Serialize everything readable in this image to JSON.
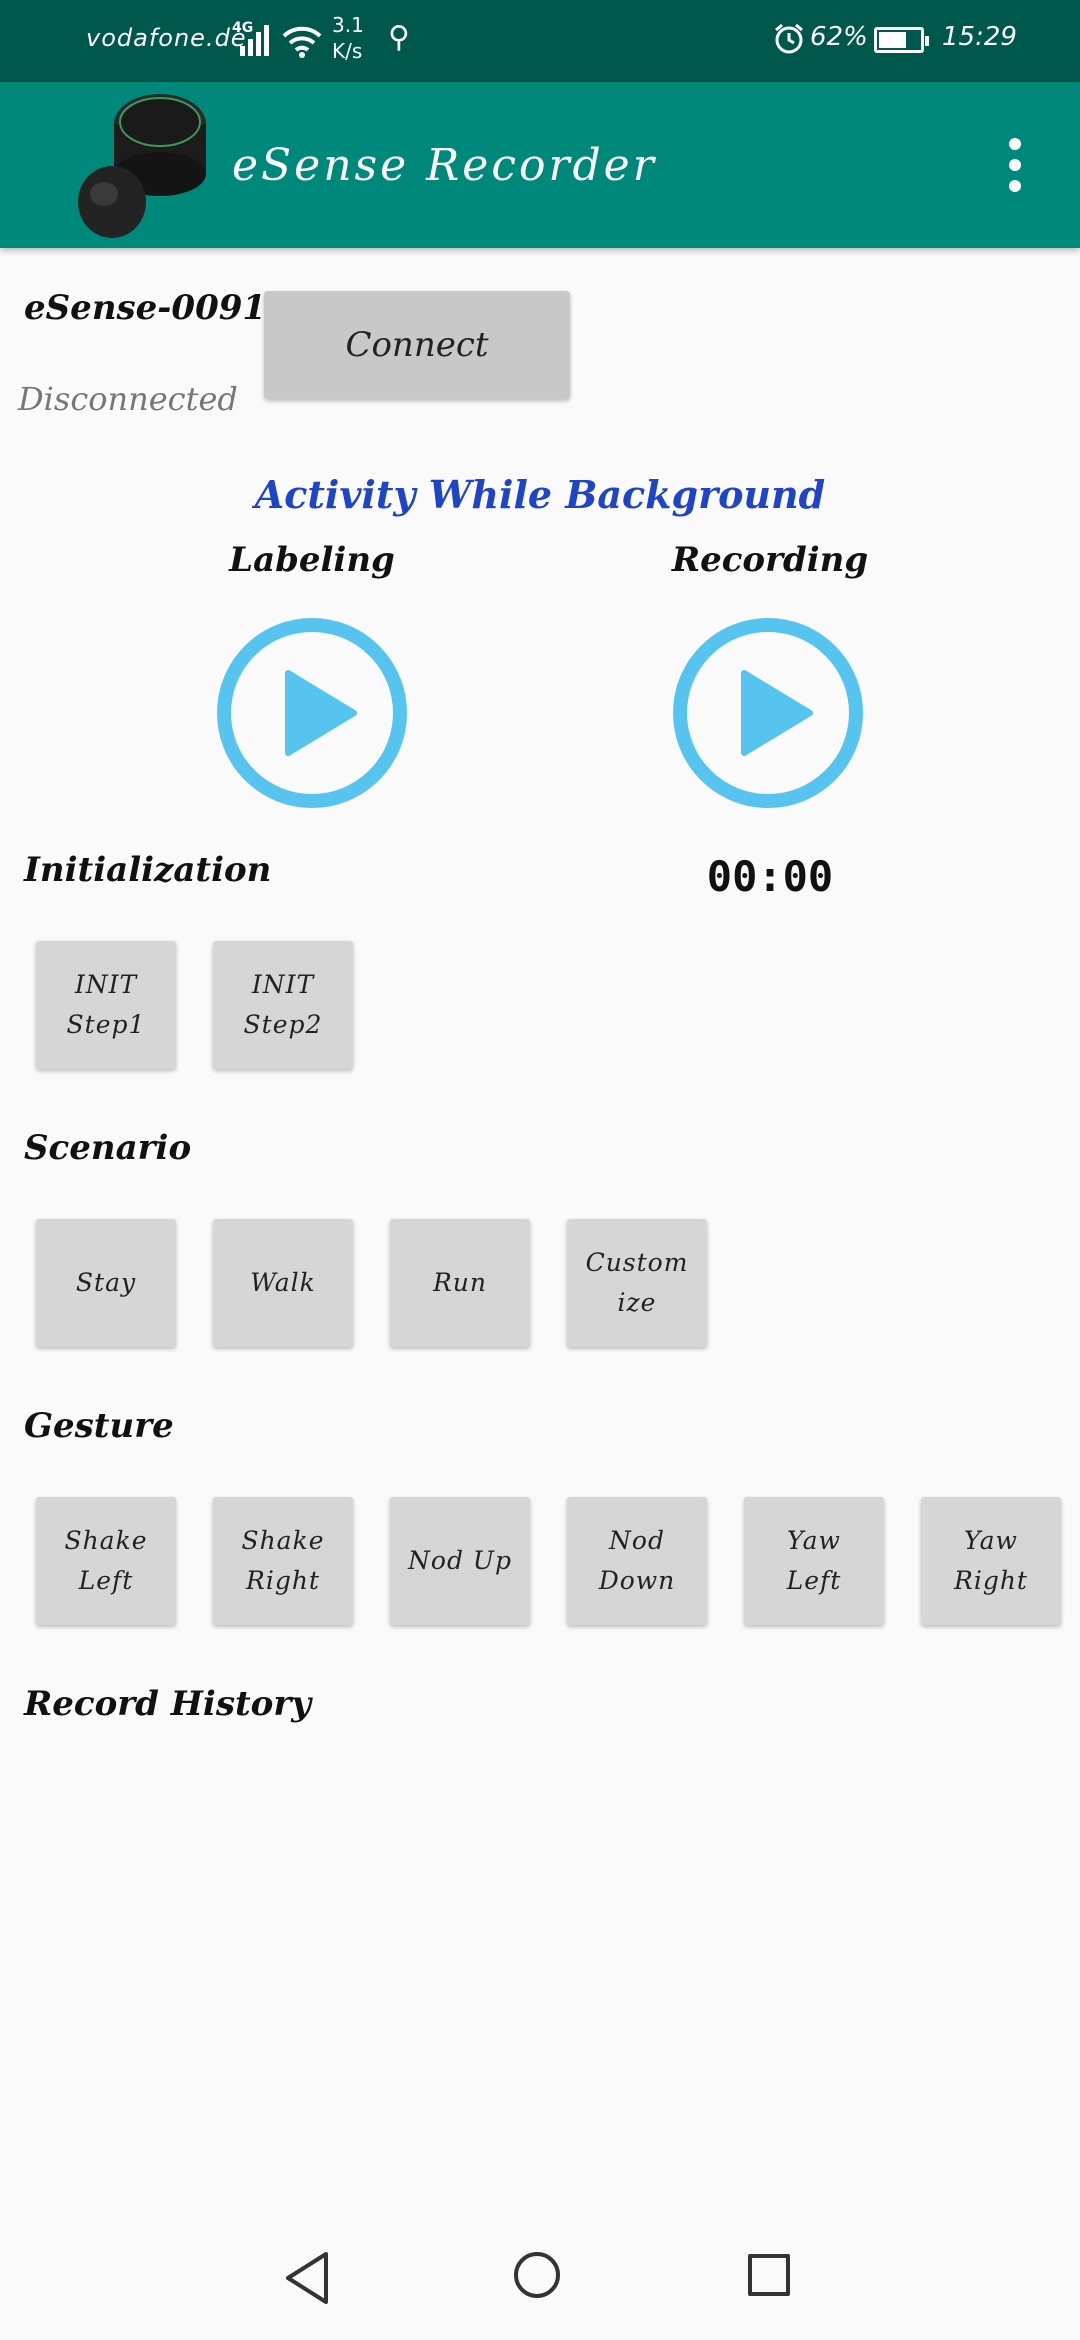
{
  "status_bar": {
    "carrier": "vodafone.de",
    "network": "4G",
    "speed_value": "3.1",
    "speed_unit": "K/s",
    "battery_percent": "62%",
    "time": "15:29"
  },
  "app_bar": {
    "title": "eSense Recorder"
  },
  "device": {
    "name": "eSense-0091",
    "status": "Disconnected",
    "connect_label": "Connect"
  },
  "activity": {
    "title": "Activity While Background",
    "labeling_label": "Labeling",
    "recording_label": "Recording",
    "timer": "00:00"
  },
  "initialization": {
    "title": "Initialization",
    "buttons": [
      "INIT\nStep1",
      "INIT\nStep2"
    ]
  },
  "scenario": {
    "title": "Scenario",
    "buttons": [
      "Stay",
      "Walk",
      "Run",
      "Custom\nize"
    ]
  },
  "gesture": {
    "title": "Gesture",
    "buttons": [
      "Shake\nLeft",
      "Shake\nRight",
      "Nod Up",
      "Nod\nDown",
      "Yaw\nLeft",
      "Yaw\nRight"
    ]
  },
  "history": {
    "title": "Record History"
  },
  "colors": {
    "status_bar": "#00574b",
    "app_bar": "#00897b",
    "accent_blue": "#1e44c8",
    "play_icon": "#56c4ee"
  }
}
